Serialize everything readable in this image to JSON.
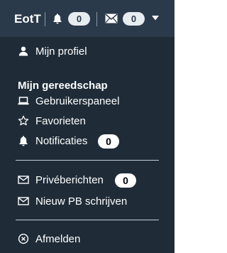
{
  "header": {
    "logo": "EotT",
    "notifications_count": "0",
    "messages_count": "0",
    "icons": [
      "bell-icon",
      "mail-icon",
      "caret-down-icon"
    ]
  },
  "menu": {
    "profile": {
      "label": "Mijn profiel",
      "icon": "user-icon"
    },
    "section_heading": "Mijn gereedschap",
    "tools": [
      {
        "label": "Gebruikerspaneel",
        "icon": "laptop-icon"
      },
      {
        "label": "Favorieten",
        "icon": "star-icon"
      },
      {
        "label": "Notificaties",
        "icon": "bell-icon",
        "count": "0"
      }
    ],
    "messages": [
      {
        "label": "Privéberichten",
        "icon": "mail-icon",
        "count": "0"
      },
      {
        "label": "Nieuw PB schrijven",
        "icon": "mail-icon"
      }
    ],
    "logout": {
      "label": "Afmelden",
      "icon": "close-circle-icon"
    }
  },
  "colors": {
    "header_bg": "#2b3a4a",
    "menu_bg": "#1f2c38",
    "text": "#ffffff",
    "badge_bg": "#e7ecf1"
  }
}
